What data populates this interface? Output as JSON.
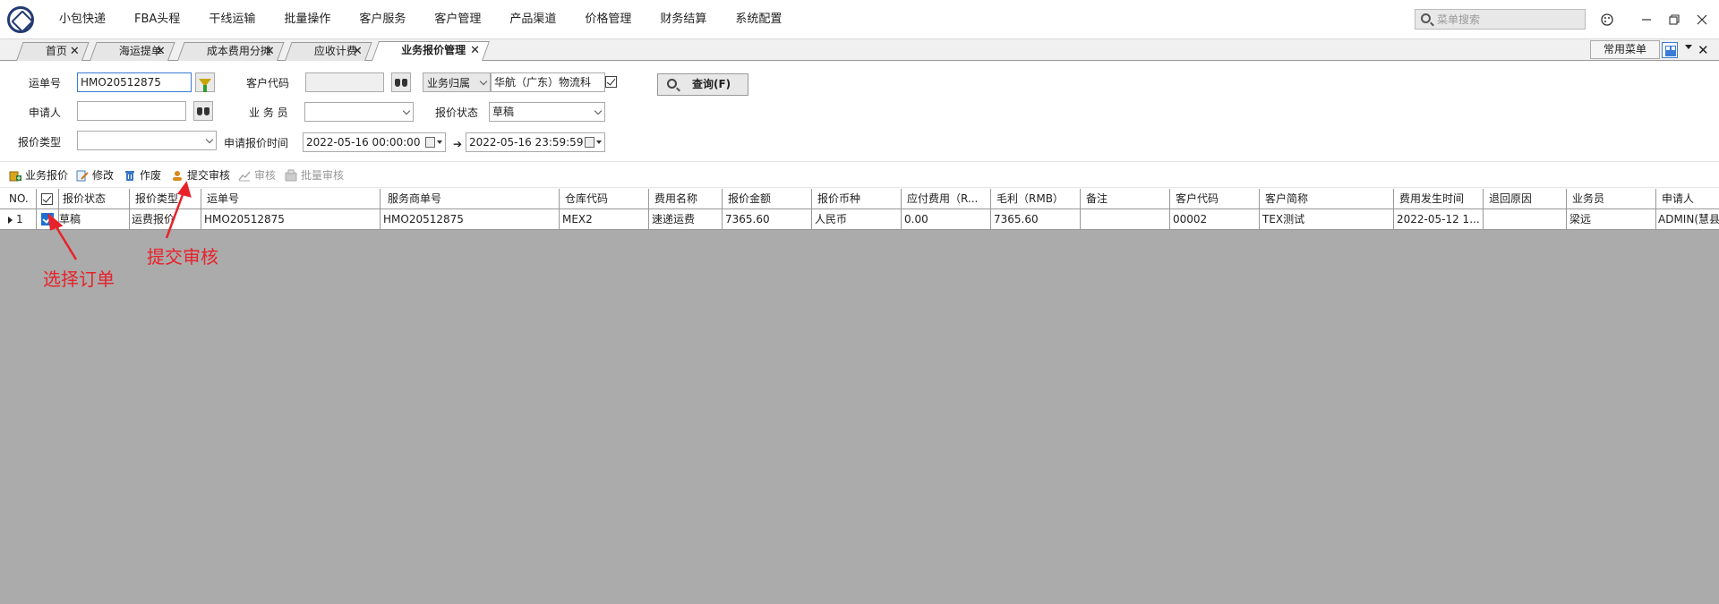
{
  "menu": [
    "小包快递",
    "FBA头程",
    "干线运输",
    "批量操作",
    "客户服务",
    "客户管理",
    "产品渠道",
    "价格管理",
    "财务结算",
    "系统配置"
  ],
  "search": {
    "placeholder": "菜单搜索"
  },
  "tabs": [
    {
      "label": "首页"
    },
    {
      "label": "海运提单"
    },
    {
      "label": "成本费用分摊"
    },
    {
      "label": "应收计费"
    },
    {
      "label": "业务报价管理",
      "active": true
    }
  ],
  "common_menu": "常用菜单",
  "form": {
    "waybill_label": "运单号",
    "waybill_value": "HMO20512875",
    "customer_code_label": "客户代码",
    "customer_code_value": "",
    "owner_select": "业务归属",
    "owner_value": "华航（广东）物流科",
    "applicant_label": "申请人",
    "applicant_value": "",
    "salesman_label": "业 务 员",
    "salesman_value": "",
    "status_label": "报价状态",
    "status_value": "草稿",
    "type_label": "报价类型",
    "type_value": "",
    "time_label": "申请报价时间",
    "time_from": "2022-05-16 00:00:00",
    "time_to": "2022-05-16 23:59:59",
    "query_button": "查询(F)"
  },
  "toolbar": {
    "quote": "业务报价",
    "edit": "修改",
    "void": "作废",
    "submit": "提交审核",
    "audit": "审核",
    "batch_audit": "批量审核"
  },
  "grid": {
    "columns": [
      "NO.",
      "",
      "报价状态",
      "报价类型",
      "运单号",
      "服务商单号",
      "仓库代码",
      "费用名称",
      "报价金额",
      "报价币种",
      "应付费用（R...",
      "毛利（RMB）",
      "备注",
      "客户代码",
      "客户简称",
      "费用发生时间",
      "退回原因",
      "业务员",
      "申请人"
    ],
    "rows": [
      {
        "no": "1",
        "status": "草稿",
        "type": "运费报价",
        "waybill": "HMO20512875",
        "provider_no": "HMO20512875",
        "warehouse": "MEX2",
        "fee_name": "速递运费",
        "amount": "7365.60",
        "currency": "人民币",
        "payable": "0.00",
        "profit": "7365.60",
        "remark": "",
        "customer_code": "00002",
        "customer_name": "TEX测试",
        "fee_time": "2022-05-12 1...",
        "return_reason": "",
        "salesman": "梁远",
        "applicant": "ADMIN(慧县"
      }
    ]
  },
  "annotations": {
    "select_order": "选择订单",
    "submit_audit": "提交审核"
  },
  "colors": {
    "annotation": "#e8222a",
    "selection": "#1f6fd1",
    "grid_background": "#ababab"
  }
}
